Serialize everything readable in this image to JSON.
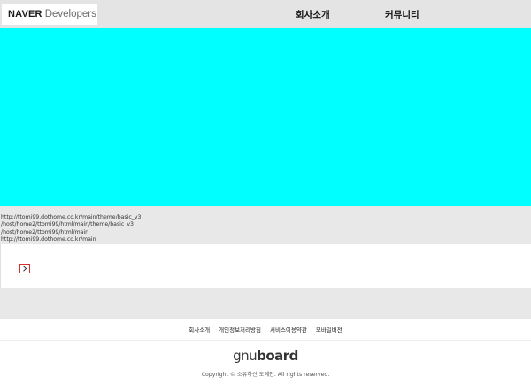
{
  "header": {
    "logo": {
      "brand": "NAVER",
      "product": "Developers"
    },
    "nav": [
      {
        "label": "회사소개"
      },
      {
        "label": "커뮤니티"
      }
    ]
  },
  "colors": {
    "header_bg": "#e4e4e4",
    "hero_bg": "#00ffff",
    "band_bg": "#e8e8e8",
    "next_button_border": "#d43030"
  },
  "paths": [
    "http://ttomi99.dothome.co.kr/main/theme/basic_v3",
    "/host/home2/ttomi99/html/main/theme/basic_v3",
    "/host/home2/ttomi99/html/main",
    "http://ttomi99.dothome.co.kr/main"
  ],
  "content": {
    "next_button_icon": "chevron-right-icon"
  },
  "footer": {
    "links": [
      {
        "label": "회사소개"
      },
      {
        "label": "개인정보처리방침"
      },
      {
        "label": "서비스이용약관"
      },
      {
        "label": "모바일버전"
      }
    ],
    "logo": {
      "light": "gnu",
      "bold": "board"
    },
    "copyright": "Copyright © 소유하신 도메인. All rights reserved."
  }
}
